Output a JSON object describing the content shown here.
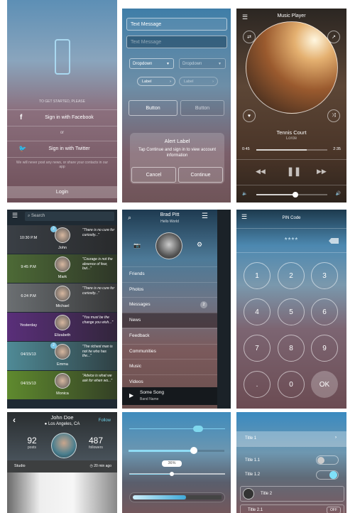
{
  "login": {
    "intro": "TO GET STARTED, PLEASE",
    "facebook": "Sign in with Facebook",
    "or": "or",
    "twitter": "Sign in with Twitter",
    "disclaimer": "We will never post any news, or share your contacts in our app",
    "login": "Login",
    "icons": {
      "device": "smartphone-icon",
      "facebook": "facebook-icon",
      "twitter": "twitter-icon"
    }
  },
  "controls": {
    "field1": "Text Message",
    "field2_placeholder": "Text Message",
    "dropdown1": "Dropdown",
    "dropdown2": "Dropdown",
    "label1": "Label",
    "label2": "Label",
    "button1": "Button",
    "button2": "Button",
    "alert": {
      "title": "Alert Label",
      "message": "Tap Continue and sign in to view account information",
      "cancel": "Cancel",
      "continue": "Continue"
    }
  },
  "player": {
    "title": "Music Player",
    "song": "Tennis Court",
    "artist": "Lorde",
    "elapsed": "0:45",
    "total": "2:35",
    "progress": 0.71,
    "volume": 0.55
  },
  "feed": {
    "search_placeholder": "Search",
    "rows": [
      {
        "time": "10:30 P.M",
        "name": "John",
        "quote": "\"There is no cure for curiosity...\"",
        "badge": "2",
        "bg": "#3a3f45"
      },
      {
        "time": "9:45 P.M",
        "name": "Mark",
        "quote": "\"Courage is not the absence of fear, but...\"",
        "bg": "#4d6a36"
      },
      {
        "time": "6:24 P.M",
        "name": "Michael",
        "quote": "\"There is no cure for curiosity...\"",
        "bg": "#6b6f72"
      },
      {
        "time": "Yesterday",
        "name": "Elizabeth",
        "quote": "\"You must be the change you wish...\"",
        "bg": "#5a2f7a"
      },
      {
        "time": "04/15/13",
        "name": "Emma",
        "quote": "\"The richest man is not he who has the...\"",
        "badge": "2",
        "bg": "#4f8a96"
      },
      {
        "time": "04/15/13",
        "name": "Monica",
        "quote": "\"Advice is what we ask for when wo...\"",
        "bg": "#5f8a2e"
      }
    ]
  },
  "menu": {
    "name": "Brad Pitt",
    "status": "Hello World",
    "items": [
      {
        "label": "Friends"
      },
      {
        "label": "Photos"
      },
      {
        "label": "Messages",
        "badge": "2"
      },
      {
        "label": "News",
        "active": true
      },
      {
        "label": "Feedback"
      },
      {
        "label": "Communities"
      },
      {
        "label": "Music"
      },
      {
        "label": "Videos"
      }
    ],
    "now_playing": {
      "song": "Some Song",
      "band": "Band Name"
    }
  },
  "pin": {
    "title": "PIN Code",
    "value": "****",
    "keys": [
      "1",
      "2",
      "3",
      "4",
      "5",
      "6",
      "7",
      "8",
      "9",
      ".",
      "0",
      "OK"
    ]
  },
  "profile": {
    "name": "John Doe",
    "location": "Los Angeles, CA",
    "follow": "Follow",
    "posts": "92",
    "posts_label": "posts",
    "followers": "487",
    "followers_label": "followers",
    "album": "Studio",
    "time": "20 min ago"
  },
  "sliders": {
    "values": [
      0.72,
      0.68,
      0.44,
      0.6
    ],
    "percent_label": "36%"
  },
  "list": {
    "title1": "Title 1",
    "title11": "Title 1.1",
    "title12": "Title 1.2",
    "title2": "Title 2",
    "title21": "Title 2.1",
    "off": "OFF",
    "toggle11": false,
    "toggle12": true
  }
}
